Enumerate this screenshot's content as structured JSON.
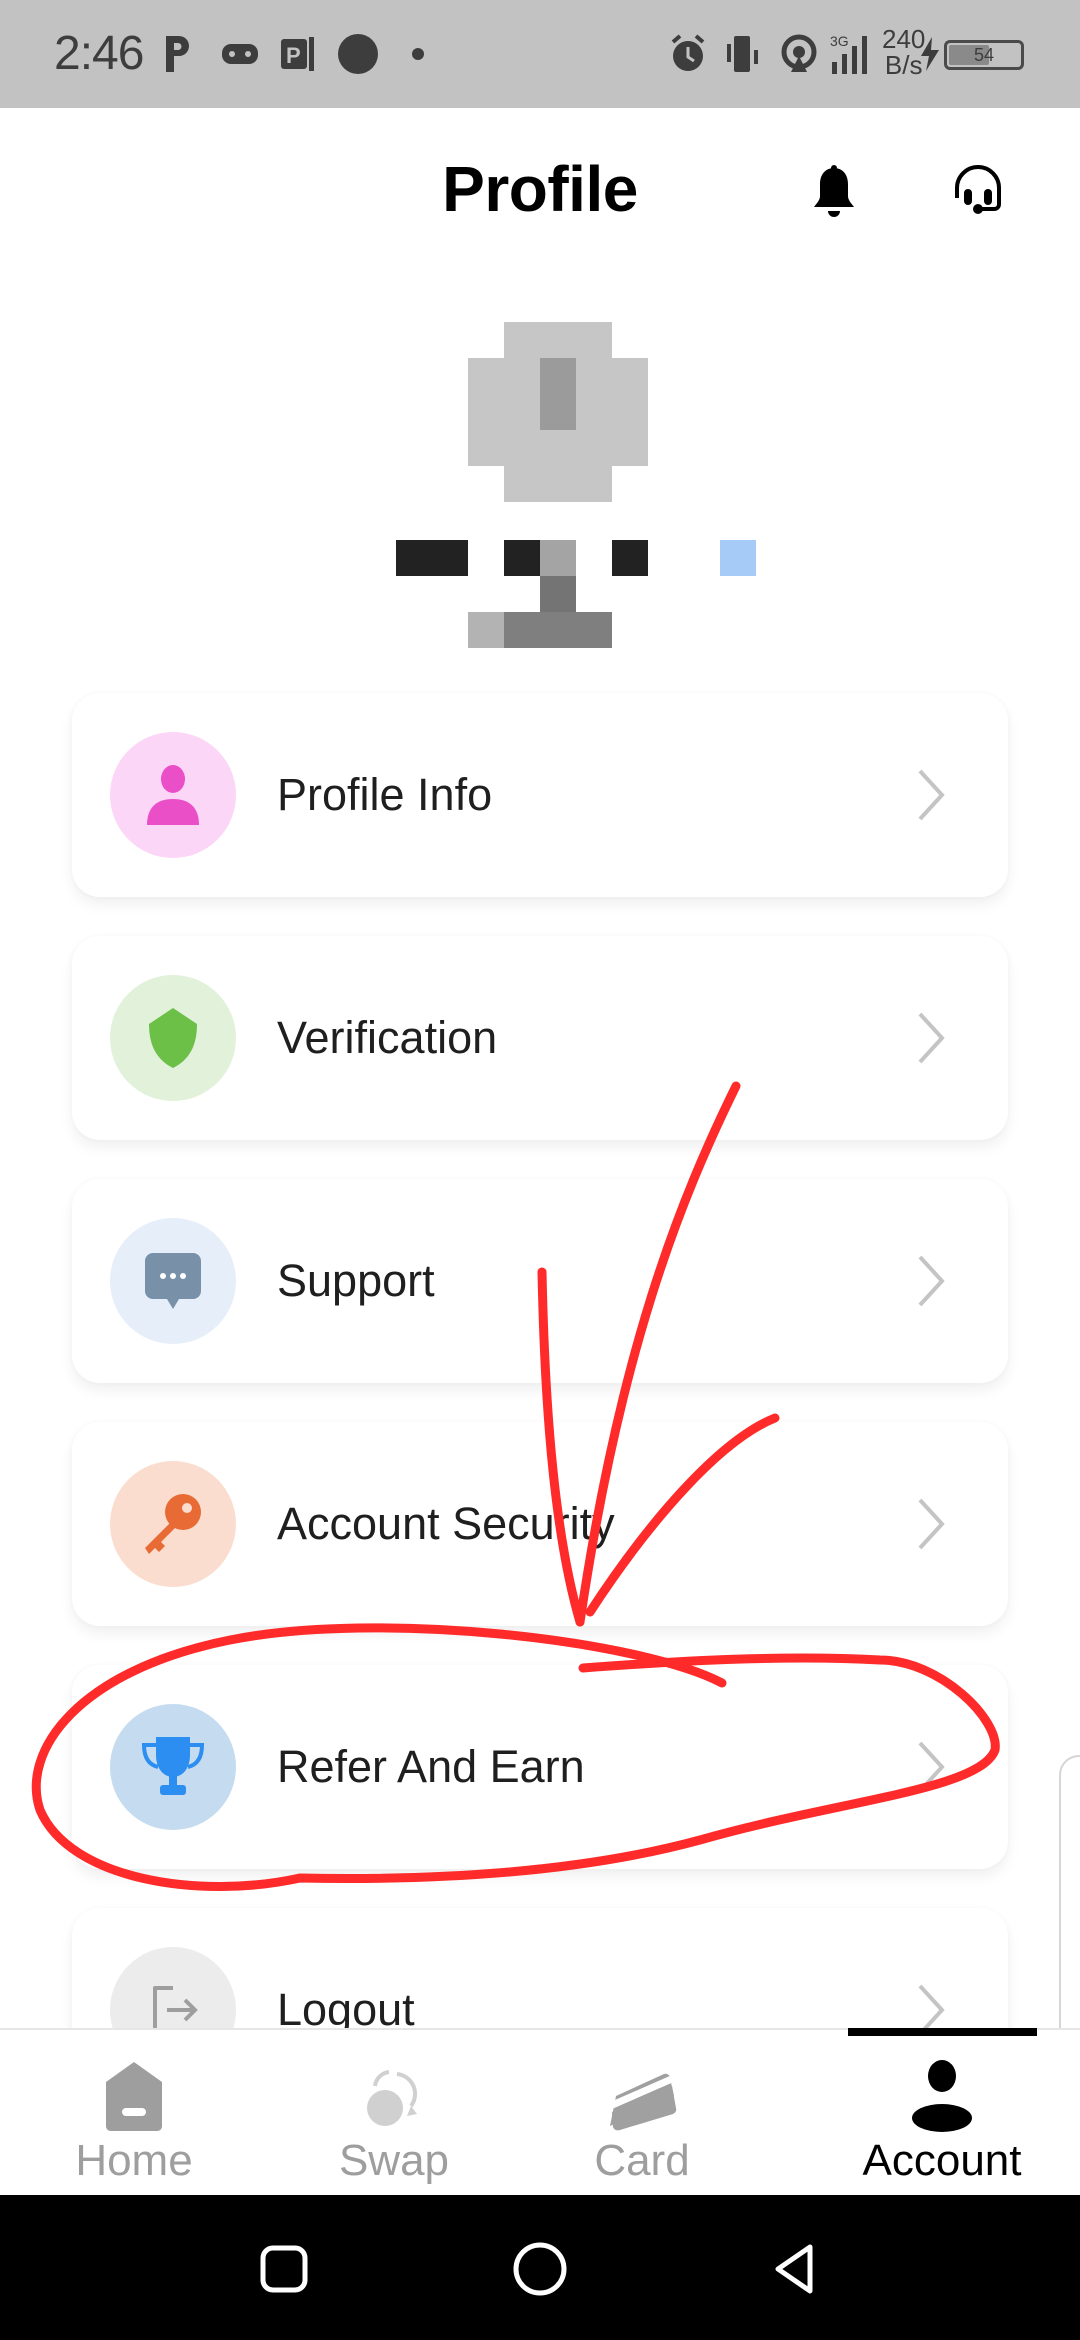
{
  "status_bar": {
    "time": "2:46",
    "network_speed_value": "240",
    "network_speed_unit": "B/s",
    "network_type": "3G",
    "battery_level": "54",
    "icons": [
      "parking-icon",
      "gamepad-icon",
      "app-notification-icon",
      "circle-notification-icon",
      "dot-icon",
      "alarm-icon",
      "vibrate-icon",
      "hotspot-icon",
      "signal-icon",
      "charging-icon",
      "battery-icon"
    ]
  },
  "header": {
    "title": "Profile",
    "notification_icon": "bell-icon",
    "support_icon": "headset-icon"
  },
  "profile": {
    "avatar": "redacted",
    "name": "redacted"
  },
  "menu": {
    "items": [
      {
        "label": "Profile Info",
        "icon": "user-icon",
        "icon_color": "#ea4fc8",
        "bg_color": "#fcd6f6"
      },
      {
        "label": "Verification",
        "icon": "shield-icon",
        "icon_color": "#6cbf47",
        "bg_color": "#e1f1da"
      },
      {
        "label": "Support",
        "icon": "chat-bubble-icon",
        "icon_color": "#7890a8",
        "bg_color": "#e6eefa"
      },
      {
        "label": "Account Security",
        "icon": "key-icon",
        "icon_color": "#e86a35",
        "bg_color": "#fbddd0"
      },
      {
        "label": "Refer And Earn",
        "icon": "trophy-icon",
        "icon_color": "#2b8ef0",
        "bg_color": "#c5dbf0"
      },
      {
        "label": "Logout",
        "icon": "logout-icon",
        "icon_color": "#9e9e9e",
        "bg_color": "#ececec"
      }
    ]
  },
  "bottom_nav": {
    "items": [
      {
        "label": "Home",
        "icon": "home-icon",
        "active": false
      },
      {
        "label": "Swap",
        "icon": "swap-icon",
        "active": false
      },
      {
        "label": "Card",
        "icon": "card-icon",
        "active": false
      },
      {
        "label": "Account",
        "icon": "account-icon",
        "active": true
      }
    ]
  },
  "system_nav": {
    "buttons": [
      "recents-icon",
      "home-circle-icon",
      "back-icon"
    ]
  },
  "annotation": {
    "color": "#ff2a2a",
    "description": "hand-drawn arrow pointing to circled Refer And Earn item"
  }
}
